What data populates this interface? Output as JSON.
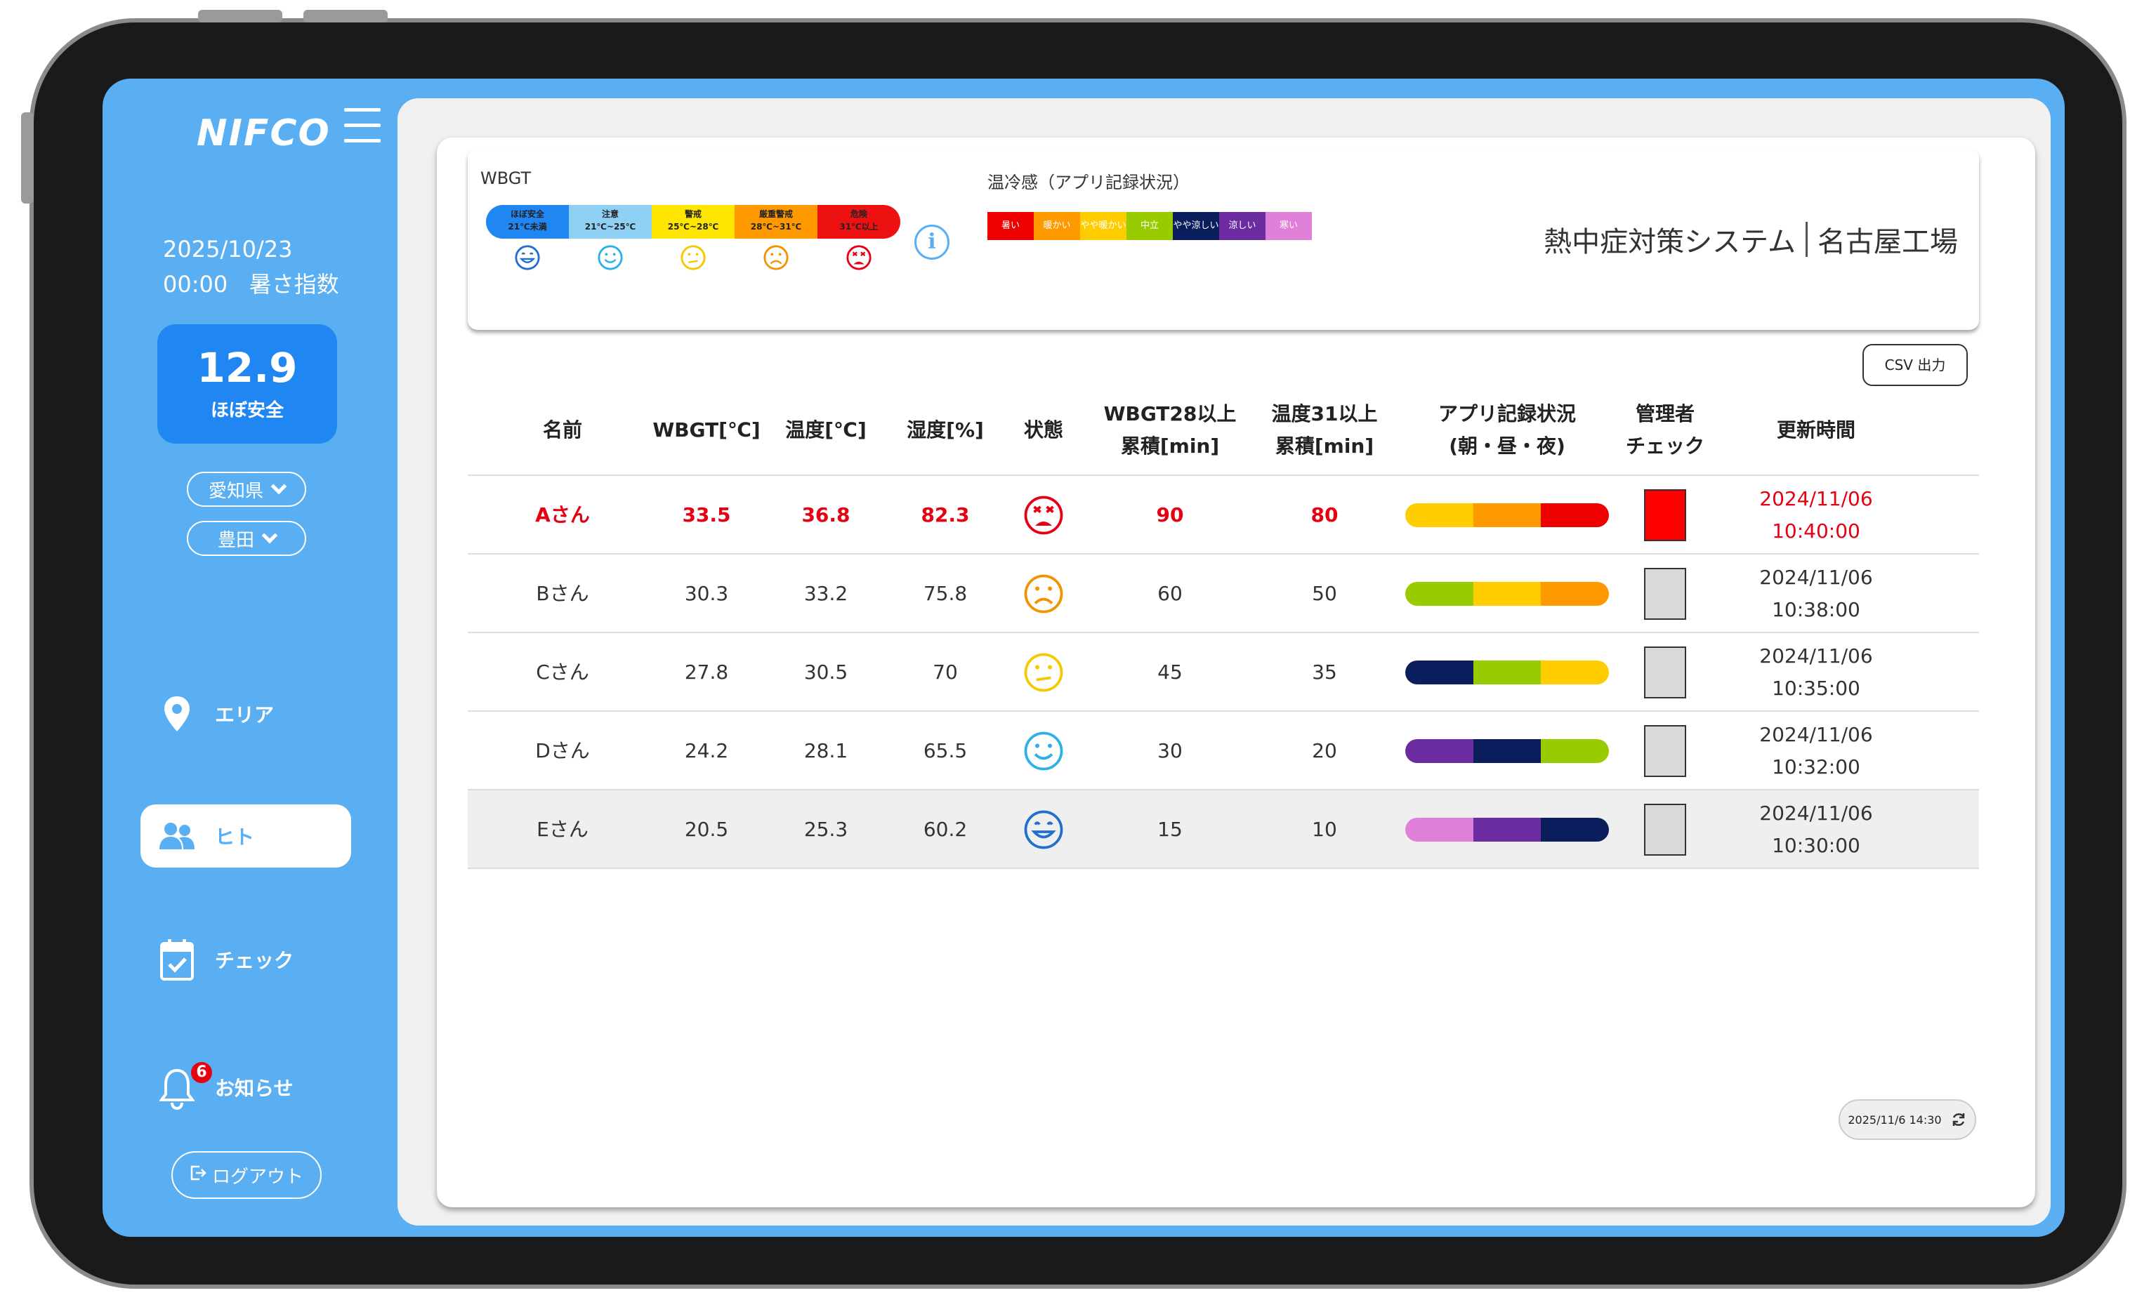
{
  "brand": {
    "logo": "NIFCO"
  },
  "sidebar": {
    "date": "2025/10/23",
    "time": "00:00",
    "index_label": "暑さ指数",
    "wbgt_value": "12.9",
    "wbgt_status": "ほぼ安全",
    "prefecture": "愛知県",
    "city": "豊田",
    "nav": [
      {
        "label": "エリア",
        "icon": "map-pin-icon",
        "active": false
      },
      {
        "label": "ヒト",
        "icon": "people-icon",
        "active": true
      },
      {
        "label": "チェック",
        "icon": "calendar-check-icon",
        "active": false
      },
      {
        "label": "お知らせ",
        "icon": "bell-icon",
        "active": false,
        "badge": "6"
      }
    ],
    "logout_label": "ログアウト"
  },
  "legend": {
    "wbgt_title": "WBGT",
    "wbgt_levels": [
      {
        "name": "ほぼ安全",
        "range": "21℃未満",
        "color": "#1f86f2",
        "face_color": "#1f6fd0"
      },
      {
        "name": "注意",
        "range": "21℃~25℃",
        "color": "#8fd0f5",
        "face_color": "#2bb0ea"
      },
      {
        "name": "警戒",
        "range": "25℃~28℃",
        "color": "#ffe600",
        "face_color": "#f5c800"
      },
      {
        "name": "厳重警戒",
        "range": "28℃~31℃",
        "color": "#ff9900",
        "face_color": "#f29400"
      },
      {
        "name": "危険",
        "range": "31℃以上",
        "color": "#ee1111",
        "face_color": "#e60012"
      }
    ],
    "feel_title": "温冷感（アプリ記録状況）",
    "feel_levels": [
      {
        "label": "暑い",
        "color": "#ee0000"
      },
      {
        "label": "暖かい",
        "color": "#ff9900"
      },
      {
        "label": "やや暖かい",
        "color": "#ffcc00"
      },
      {
        "label": "中立",
        "color": "#99cc00"
      },
      {
        "label": "やや涼しい",
        "color": "#0a1e5e"
      },
      {
        "label": "涼しい",
        "color": "#6a2ca0"
      },
      {
        "label": "寒い",
        "color": "#e080d8"
      }
    ],
    "system_name": "熱中症対策システム",
    "site_name": "名古屋工場"
  },
  "toolbar": {
    "csv_label": "CSV 出力"
  },
  "table": {
    "headers": {
      "name": "名前",
      "wbgt": "WBGT[℃]",
      "temp": "温度[℃]",
      "humidity": "湿度[%]",
      "state": "状態",
      "wbgt28_1": "WBGT28以上",
      "wbgt28_2": "累積[min]",
      "temp31_1": "温度31以上",
      "temp31_2": "累積[min]",
      "app_1": "アプリ記録状況",
      "app_2": "(朝・昼・夜)",
      "admin_1": "管理者",
      "admin_2": "チェック",
      "updated": "更新時間"
    },
    "rows": [
      {
        "name": "Aさん",
        "wbgt": "33.5",
        "temp": "36.8",
        "humidity": "82.3",
        "face": "danger-face-icon",
        "wbgt28": "90",
        "temp31": "80",
        "app": [
          "#ffcc00",
          "#ff9900",
          "#ee0000"
        ],
        "checked": true,
        "date": "2024/11/06",
        "time": "10:40:00"
      },
      {
        "name": "Bさん",
        "wbgt": "30.3",
        "temp": "33.2",
        "humidity": "75.8",
        "face": "severe-caution-face-icon",
        "wbgt28": "60",
        "temp31": "50",
        "app": [
          "#99cc00",
          "#ffcc00",
          "#ff9900"
        ],
        "checked": false,
        "date": "2024/11/06",
        "time": "10:38:00"
      },
      {
        "name": "Cさん",
        "wbgt": "27.8",
        "temp": "30.5",
        "humidity": "70",
        "face": "caution-face-icon",
        "wbgt28": "45",
        "temp31": "35",
        "app": [
          "#0a1e5e",
          "#99cc00",
          "#ffcc00"
        ],
        "checked": false,
        "date": "2024/11/06",
        "time": "10:35:00"
      },
      {
        "name": "Dさん",
        "wbgt": "24.2",
        "temp": "28.1",
        "humidity": "65.5",
        "face": "attention-face-icon",
        "wbgt28": "30",
        "temp31": "20",
        "app": [
          "#6a2ca0",
          "#0a1e5e",
          "#99cc00"
        ],
        "checked": false,
        "date": "2024/11/06",
        "time": "10:32:00"
      },
      {
        "name": "Eさん",
        "wbgt": "20.5",
        "temp": "25.3",
        "humidity": "60.2",
        "face": "safe-face-icon",
        "wbgt28": "15",
        "temp31": "10",
        "app": [
          "#e080d8",
          "#6a2ca0",
          "#0a1e5e"
        ],
        "checked": false,
        "date": "2024/11/06",
        "time": "10:30:00"
      }
    ]
  },
  "footer": {
    "last_refresh": "2025/11/6 14:30"
  },
  "colors": {
    "sidebar": "#5aaef2",
    "accent": "#1f86f2",
    "danger": "#e60012"
  }
}
